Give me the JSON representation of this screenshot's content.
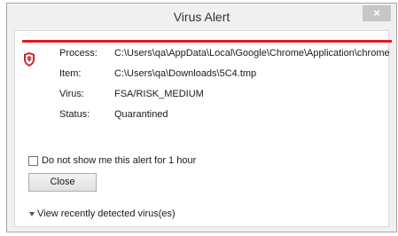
{
  "window": {
    "title": "Virus Alert",
    "close_glyph": "×"
  },
  "colors": {
    "alert_red": "#e3191e",
    "window_bg": "#f0f0f0",
    "close_button_bg": "#c7c7c7"
  },
  "icons": {
    "shield": "shield-icon",
    "close": "close-icon",
    "expand": "triangle-down-icon"
  },
  "details": [
    {
      "label": "Process:",
      "value": "C:\\Users\\qa\\AppData\\Local\\Google\\Chrome\\Application\\chrome.e"
    },
    {
      "label": "Item:",
      "value": "C:\\Users\\qa\\Downloads\\5C4.tmp"
    },
    {
      "label": "Virus:",
      "value": "FSA/RISK_MEDIUM"
    },
    {
      "label": "Status:",
      "value": "Quarantined"
    }
  ],
  "suppress_checkbox": {
    "label": "Do not show me this alert for 1 hour",
    "checked": false
  },
  "close_button": {
    "label": "Close"
  },
  "expander": {
    "label": "View recently detected virus(es)"
  }
}
